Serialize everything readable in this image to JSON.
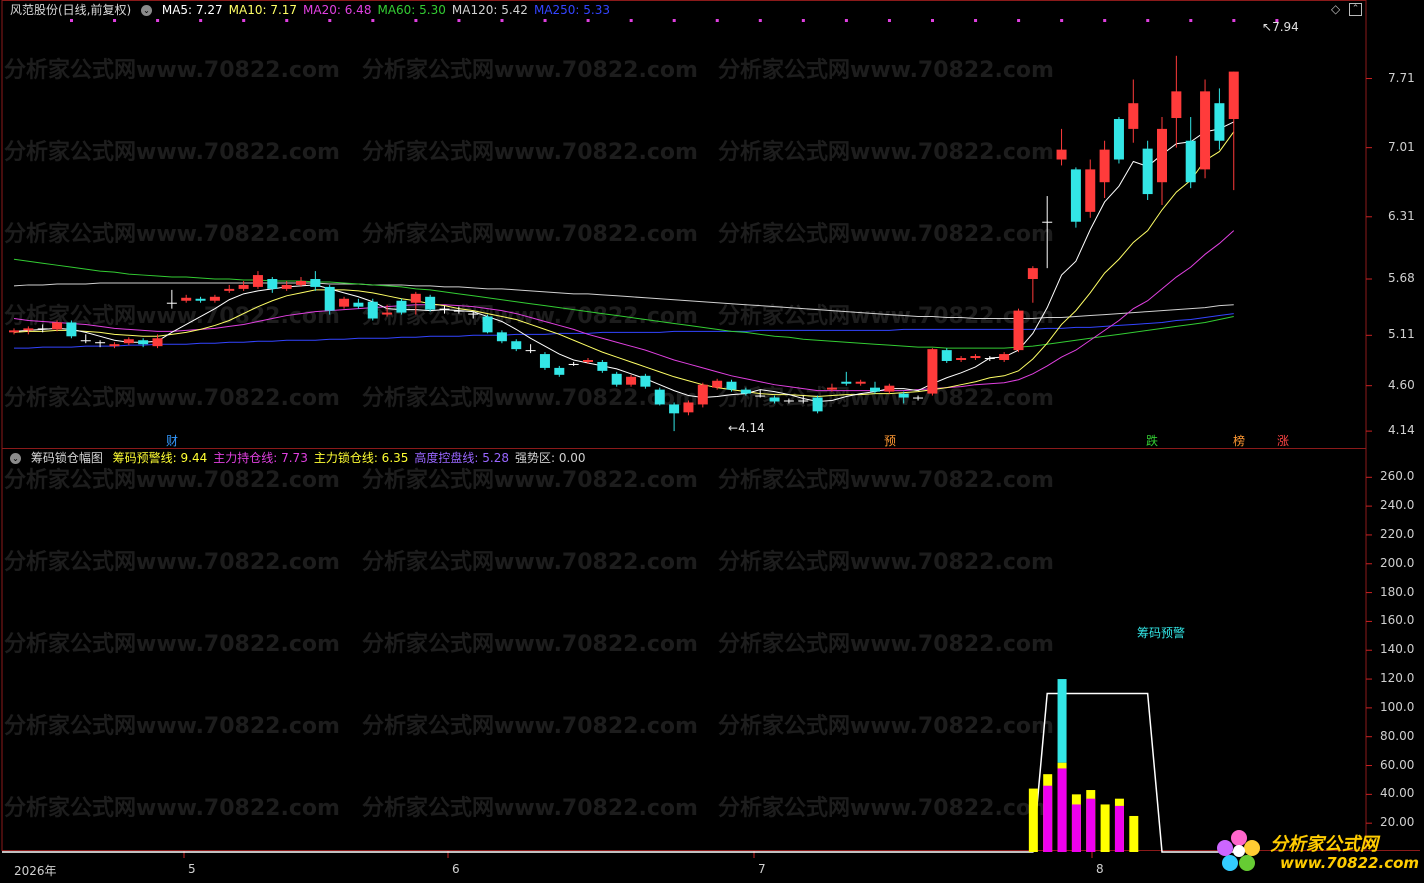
{
  "main_header": {
    "title": "风范股份(日线,前复权)",
    "indicators": [
      {
        "label": "MA5: 7.27",
        "color": "#ffffff"
      },
      {
        "label": "MA10: 7.17",
        "color": "#ffff66"
      },
      {
        "label": "MA20: 6.48",
        "color": "#e040e0"
      },
      {
        "label": "MA60: 5.30",
        "color": "#33cc33"
      },
      {
        "label": "MA120: 5.42",
        "color": "#d0d0d0"
      },
      {
        "label": "MA250: 5.33",
        "color": "#3344ff"
      }
    ]
  },
  "sub_header": {
    "title": "筹码锁仓幅图",
    "indicators": [
      {
        "label": "筹码预警线: 9.44",
        "color": "#ffff33"
      },
      {
        "label": "主力持仓线: 7.73",
        "color": "#e040e0"
      },
      {
        "label": "主力锁仓线: 6.35",
        "color": "#ffff33"
      },
      {
        "label": "高度控盘线: 5.28",
        "color": "#9966ff"
      },
      {
        "label": "强势区: 0.00",
        "color": "#d0d0d0"
      }
    ]
  },
  "price_axis": [
    "7.71",
    "7.01",
    "6.31",
    "5.68",
    "5.11",
    "4.60",
    "4.14"
  ],
  "indicator_axis": [
    "260.0",
    "240.0",
    "220.0",
    "200.0",
    "180.0",
    "160.0",
    "140.0",
    "120.0",
    "100.0",
    "80.00",
    "60.00",
    "40.00",
    "20.00"
  ],
  "x_axis": [
    "2026年",
    "5",
    "6",
    "7",
    "8"
  ],
  "annotations": {
    "high": "7.94",
    "low": "4.14",
    "sub_label": "筹码预警"
  },
  "event_markers": [
    {
      "text": "财",
      "color": "#3399ff"
    },
    {
      "text": "预",
      "color": "#ff9933"
    },
    {
      "text": "跌",
      "color": "#33cc33"
    },
    {
      "text": "榜",
      "color": "#ff9933"
    },
    {
      "text": "涨",
      "color": "#ff4444"
    }
  ],
  "watermark": "分析家公式网www.70822.com",
  "logo": {
    "brand": "分析家公式网",
    "url": "www.70822.com"
  },
  "colors": {
    "up": "#ff3b3b",
    "down": "#33e6e6",
    "bg": "#000000",
    "frame": "#8b1a1a"
  },
  "chart_data": {
    "type": "candlestick",
    "candles": [
      [
        5.14,
        5.16,
        5.12,
        5.18
      ],
      [
        5.16,
        5.18,
        5.12,
        5.2
      ],
      [
        5.18,
        5.17,
        5.14,
        5.22
      ],
      [
        5.17,
        5.24,
        5.15,
        5.26
      ],
      [
        5.24,
        5.1,
        5.08,
        5.26
      ],
      [
        5.06,
        5.05,
        5.03,
        5.12
      ],
      [
        5.04,
        5.03,
        4.99,
        5.06
      ],
      [
        5.0,
        5.02,
        4.98,
        5.04
      ],
      [
        5.03,
        5.07,
        5.01,
        5.09
      ],
      [
        5.06,
        5.02,
        4.99,
        5.08
      ],
      [
        5.0,
        5.08,
        4.98,
        5.12
      ],
      [
        5.44,
        5.44,
        5.38,
        5.57
      ],
      [
        5.46,
        5.49,
        5.44,
        5.52
      ],
      [
        5.48,
        5.46,
        5.44,
        5.5
      ],
      [
        5.46,
        5.5,
        5.44,
        5.52
      ],
      [
        5.56,
        5.58,
        5.54,
        5.62
      ],
      [
        5.58,
        5.62,
        5.56,
        5.66
      ],
      [
        5.6,
        5.72,
        5.58,
        5.76
      ],
      [
        5.68,
        5.58,
        5.54,
        5.7
      ],
      [
        5.58,
        5.62,
        5.56,
        5.66
      ],
      [
        5.62,
        5.66,
        5.6,
        5.7
      ],
      [
        5.68,
        5.6,
        5.56,
        5.76
      ],
      [
        5.6,
        5.36,
        5.32,
        5.62
      ],
      [
        5.4,
        5.48,
        5.38,
        5.5
      ],
      [
        5.44,
        5.4,
        5.38,
        5.48
      ],
      [
        5.45,
        5.28,
        5.26,
        5.48
      ],
      [
        5.32,
        5.34,
        5.3,
        5.42
      ],
      [
        5.46,
        5.34,
        5.32,
        5.48
      ],
      [
        5.44,
        5.53,
        5.32,
        5.55
      ],
      [
        5.5,
        5.37,
        5.35,
        5.52
      ],
      [
        5.38,
        5.37,
        5.33,
        5.41
      ],
      [
        5.36,
        5.36,
        5.33,
        5.4
      ],
      [
        5.33,
        5.32,
        5.28,
        5.35
      ],
      [
        5.3,
        5.14,
        5.13,
        5.32
      ],
      [
        5.14,
        5.05,
        5.03,
        5.16
      ],
      [
        5.05,
        4.97,
        4.95,
        5.07
      ],
      [
        4.96,
        4.96,
        4.93,
        5.02
      ],
      [
        4.92,
        4.78,
        4.76,
        4.94
      ],
      [
        4.78,
        4.71,
        4.69,
        4.8
      ],
      [
        4.82,
        4.82,
        4.8,
        4.84
      ],
      [
        4.84,
        4.86,
        4.82,
        4.88
      ],
      [
        4.84,
        4.75,
        4.73,
        4.86
      ],
      [
        4.72,
        4.61,
        4.59,
        4.74
      ],
      [
        4.61,
        4.69,
        4.59,
        4.71
      ],
      [
        4.7,
        4.59,
        4.57,
        4.72
      ],
      [
        4.56,
        4.41,
        4.4,
        4.58
      ],
      [
        4.41,
        4.32,
        4.14,
        4.43
      ],
      [
        4.33,
        4.43,
        4.3,
        4.45
      ],
      [
        4.41,
        4.61,
        4.38,
        4.63
      ],
      [
        4.58,
        4.65,
        4.56,
        4.67
      ],
      [
        4.64,
        4.56,
        4.54,
        4.66
      ],
      [
        4.56,
        4.52,
        4.5,
        4.58
      ],
      [
        4.5,
        4.5,
        4.48,
        4.56
      ],
      [
        4.48,
        4.44,
        4.42,
        4.5
      ],
      [
        4.44,
        4.45,
        4.42,
        4.47
      ],
      [
        4.44,
        4.45,
        4.42,
        4.5
      ],
      [
        4.48,
        4.34,
        4.32,
        4.5
      ],
      [
        4.56,
        4.58,
        4.54,
        4.62
      ],
      [
        4.64,
        4.62,
        4.6,
        4.74
      ],
      [
        4.62,
        4.64,
        4.6,
        4.66
      ],
      [
        4.58,
        4.54,
        4.52,
        4.64
      ],
      [
        4.54,
        4.6,
        4.52,
        4.62
      ],
      [
        4.52,
        4.48,
        4.42,
        4.54
      ],
      [
        4.48,
        4.47,
        4.45,
        4.5
      ],
      [
        4.52,
        4.97,
        4.5,
        4.98
      ],
      [
        4.96,
        4.85,
        4.83,
        4.98
      ],
      [
        4.86,
        4.88,
        4.84,
        4.9
      ],
      [
        4.88,
        4.9,
        4.86,
        4.92
      ],
      [
        4.88,
        4.87,
        4.85,
        4.9
      ],
      [
        4.86,
        4.92,
        4.84,
        4.94
      ],
      [
        4.96,
        5.36,
        4.94,
        5.38
      ],
      [
        5.68,
        5.79,
        5.44,
        5.81
      ],
      [
        6.26,
        6.26,
        5.79,
        6.52
      ],
      [
        6.89,
        6.99,
        6.83,
        7.2
      ],
      [
        6.79,
        6.26,
        6.2,
        6.81
      ],
      [
        6.36,
        6.79,
        6.3,
        6.89
      ],
      [
        6.66,
        6.99,
        6.5,
        7.08
      ],
      [
        7.3,
        6.89,
        6.85,
        7.32
      ],
      [
        7.2,
        7.46,
        7.06,
        7.7
      ],
      [
        7.0,
        6.54,
        6.48,
        7.08
      ],
      [
        6.66,
        7.2,
        6.43,
        7.32
      ],
      [
        7.31,
        7.58,
        7.01,
        7.94
      ],
      [
        7.08,
        6.66,
        6.6,
        7.32
      ],
      [
        6.79,
        7.58,
        6.7,
        7.7
      ],
      [
        7.46,
        7.08,
        6.99,
        7.61
      ],
      [
        7.3,
        7.78,
        6.58,
        7.78
      ]
    ],
    "ma5": [
      5.15,
      5.16,
      5.17,
      5.18,
      5.17,
      5.14,
      5.1,
      5.06,
      5.04,
      5.04,
      5.05,
      5.14,
      5.22,
      5.3,
      5.38,
      5.47,
      5.53,
      5.56,
      5.58,
      5.6,
      5.61,
      5.62,
      5.58,
      5.54,
      5.5,
      5.45,
      5.38,
      5.37,
      5.37,
      5.36,
      5.37,
      5.36,
      5.35,
      5.3,
      5.25,
      5.17,
      5.08,
      5.0,
      4.92,
      4.86,
      4.83,
      4.8,
      4.77,
      4.72,
      4.67,
      4.61,
      4.55,
      4.5,
      4.48,
      4.49,
      4.51,
      4.52,
      4.56,
      4.54,
      4.51,
      4.47,
      4.44,
      4.45,
      4.49,
      4.52,
      4.54,
      4.57,
      4.57,
      4.55,
      4.62,
      4.68,
      4.73,
      4.79,
      4.88,
      4.89,
      4.96,
      5.13,
      5.39,
      5.72,
      5.86,
      6.18,
      6.46,
      6.62,
      6.87,
      6.82,
      6.94,
      7.05,
      7.07,
      7.17,
      7.2,
      7.27
    ],
    "ma10": [
      5.14,
      5.15,
      5.15,
      5.16,
      5.16,
      5.15,
      5.14,
      5.12,
      5.11,
      5.1,
      5.1,
      5.12,
      5.14,
      5.17,
      5.21,
      5.26,
      5.33,
      5.4,
      5.46,
      5.51,
      5.54,
      5.57,
      5.57,
      5.57,
      5.56,
      5.54,
      5.51,
      5.48,
      5.46,
      5.43,
      5.41,
      5.38,
      5.36,
      5.33,
      5.3,
      5.27,
      5.22,
      5.17,
      5.12,
      5.06,
      5.0,
      4.94,
      4.89,
      4.84,
      4.79,
      4.74,
      4.69,
      4.65,
      4.61,
      4.58,
      4.56,
      4.54,
      4.52,
      4.51,
      4.51,
      4.5,
      4.49,
      4.5,
      4.51,
      4.51,
      4.52,
      4.52,
      4.53,
      4.54,
      4.56,
      4.58,
      4.61,
      4.64,
      4.68,
      4.7,
      4.75,
      4.87,
      5.03,
      5.22,
      5.36,
      5.54,
      5.74,
      5.88,
      6.05,
      6.17,
      6.38,
      6.56,
      6.68,
      6.88,
      6.97,
      7.17
    ],
    "ma20": [
      5.28,
      5.26,
      5.25,
      5.24,
      5.23,
      5.22,
      5.2,
      5.18,
      5.17,
      5.16,
      5.15,
      5.15,
      5.16,
      5.17,
      5.18,
      5.2,
      5.22,
      5.25,
      5.28,
      5.31,
      5.33,
      5.35,
      5.36,
      5.37,
      5.38,
      5.39,
      5.4,
      5.41,
      5.42,
      5.42,
      5.42,
      5.41,
      5.4,
      5.38,
      5.36,
      5.33,
      5.29,
      5.25,
      5.21,
      5.17,
      5.12,
      5.08,
      5.04,
      5.0,
      4.96,
      4.91,
      4.86,
      4.82,
      4.78,
      4.74,
      4.7,
      4.67,
      4.64,
      4.61,
      4.59,
      4.57,
      4.55,
      4.55,
      4.55,
      4.55,
      4.55,
      4.55,
      4.55,
      4.56,
      4.57,
      4.58,
      4.59,
      4.61,
      4.62,
      4.63,
      4.66,
      4.72,
      4.8,
      4.89,
      4.96,
      5.06,
      5.16,
      5.26,
      5.38,
      5.46,
      5.58,
      5.7,
      5.8,
      5.93,
      6.04,
      6.17
    ],
    "ma60": [
      5.88,
      5.86,
      5.84,
      5.82,
      5.8,
      5.78,
      5.76,
      5.75,
      5.73,
      5.72,
      5.71,
      5.7,
      5.7,
      5.69,
      5.68,
      5.68,
      5.67,
      5.67,
      5.66,
      5.66,
      5.66,
      5.65,
      5.65,
      5.64,
      5.63,
      5.62,
      5.61,
      5.6,
      5.58,
      5.57,
      5.55,
      5.53,
      5.51,
      5.49,
      5.47,
      5.45,
      5.43,
      5.41,
      5.39,
      5.37,
      5.35,
      5.33,
      5.31,
      5.29,
      5.27,
      5.25,
      5.23,
      5.21,
      5.19,
      5.17,
      5.15,
      5.14,
      5.12,
      5.1,
      5.09,
      5.07,
      5.06,
      5.05,
      5.04,
      5.03,
      5.02,
      5.01,
      5.0,
      4.99,
      4.99,
      4.98,
      4.98,
      4.98,
      4.98,
      4.98,
      4.99,
      5.0,
      5.02,
      5.04,
      5.06,
      5.08,
      5.1,
      5.12,
      5.14,
      5.16,
      5.18,
      5.2,
      5.22,
      5.24,
      5.27,
      5.3
    ],
    "ma120": [
      5.61,
      5.62,
      5.62,
      5.63,
      5.63,
      5.63,
      5.64,
      5.64,
      5.64,
      5.64,
      5.64,
      5.64,
      5.64,
      5.64,
      5.64,
      5.64,
      5.64,
      5.64,
      5.64,
      5.64,
      5.64,
      5.64,
      5.63,
      5.63,
      5.63,
      5.62,
      5.62,
      5.62,
      5.61,
      5.61,
      5.6,
      5.6,
      5.59,
      5.58,
      5.58,
      5.57,
      5.56,
      5.55,
      5.54,
      5.53,
      5.53,
      5.52,
      5.51,
      5.5,
      5.49,
      5.48,
      5.47,
      5.46,
      5.45,
      5.44,
      5.43,
      5.42,
      5.41,
      5.4,
      5.39,
      5.38,
      5.37,
      5.36,
      5.35,
      5.34,
      5.33,
      5.32,
      5.31,
      5.3,
      5.3,
      5.29,
      5.29,
      5.28,
      5.28,
      5.28,
      5.28,
      5.28,
      5.29,
      5.29,
      5.3,
      5.31,
      5.32,
      5.33,
      5.34,
      5.35,
      5.36,
      5.37,
      5.38,
      5.39,
      5.41,
      5.42
    ],
    "ma250": [
      4.98,
      4.98,
      4.99,
      4.99,
      4.99,
      5.0,
      5.0,
      5.0,
      5.01,
      5.01,
      5.02,
      5.02,
      5.02,
      5.03,
      5.03,
      5.04,
      5.04,
      5.05,
      5.05,
      5.06,
      5.06,
      5.06,
      5.07,
      5.07,
      5.08,
      5.08,
      5.08,
      5.09,
      5.09,
      5.1,
      5.1,
      5.1,
      5.11,
      5.11,
      5.11,
      5.12,
      5.12,
      5.12,
      5.13,
      5.13,
      5.13,
      5.14,
      5.14,
      5.14,
      5.14,
      5.14,
      5.15,
      5.15,
      5.15,
      5.15,
      5.15,
      5.15,
      5.16,
      5.16,
      5.16,
      5.16,
      5.16,
      5.16,
      5.16,
      5.16,
      5.16,
      5.16,
      5.17,
      5.17,
      5.17,
      5.17,
      5.17,
      5.17,
      5.17,
      5.17,
      5.17,
      5.17,
      5.18,
      5.18,
      5.19,
      5.19,
      5.2,
      5.21,
      5.22,
      5.23,
      5.24,
      5.26,
      5.27,
      5.29,
      5.31,
      5.33
    ],
    "indicator": {
      "envelope": [
        0,
        0,
        0,
        0,
        0,
        0,
        0,
        0,
        0,
        0,
        0,
        0,
        0,
        0,
        0,
        0,
        0,
        0,
        0,
        0,
        0,
        0,
        0,
        0,
        0,
        0,
        0,
        0,
        0,
        0,
        0,
        0,
        0,
        0,
        0,
        0,
        0,
        0,
        0,
        0,
        0,
        0,
        0,
        0,
        0,
        0,
        0,
        0,
        0,
        0,
        0,
        0,
        0,
        0,
        0,
        0,
        0,
        0,
        0,
        0,
        0,
        0,
        0,
        0,
        0,
        0,
        0,
        0,
        0,
        0,
        0,
        0,
        110,
        110,
        110,
        110,
        110,
        110,
        110,
        110,
        0,
        0,
        0,
        0,
        0,
        0
      ],
      "yellow": [
        0,
        0,
        0,
        0,
        0,
        0,
        0,
        0,
        0,
        0,
        0,
        0,
        0,
        0,
        0,
        0,
        0,
        0,
        0,
        0,
        0,
        0,
        0,
        0,
        0,
        0,
        0,
        0,
        0,
        0,
        0,
        0,
        0,
        0,
        0,
        0,
        0,
        0,
        0,
        0,
        0,
        0,
        0,
        0,
        0,
        0,
        0,
        0,
        0,
        0,
        0,
        0,
        0,
        0,
        0,
        0,
        0,
        0,
        0,
        0,
        0,
        0,
        0,
        0,
        0,
        0,
        0,
        0,
        0,
        0,
        0,
        44,
        54,
        62,
        40,
        43,
        33,
        37,
        25,
        0,
        0,
        0,
        0,
        0,
        0,
        0
      ],
      "magenta": [
        0,
        0,
        0,
        0,
        0,
        0,
        0,
        0,
        0,
        0,
        0,
        0,
        0,
        0,
        0,
        0,
        0,
        0,
        0,
        0,
        0,
        0,
        0,
        0,
        0,
        0,
        0,
        0,
        0,
        0,
        0,
        0,
        0,
        0,
        0,
        0,
        0,
        0,
        0,
        0,
        0,
        0,
        0,
        0,
        0,
        0,
        0,
        0,
        0,
        0,
        0,
        0,
        0,
        0,
        0,
        0,
        0,
        0,
        0,
        0,
        0,
        0,
        0,
        0,
        0,
        0,
        0,
        0,
        0,
        0,
        0,
        0,
        46,
        58,
        33,
        37,
        0,
        32,
        0,
        0,
        0,
        0,
        0,
        0,
        0,
        0
      ],
      "cyan": [
        0,
        0,
        0,
        0,
        0,
        0,
        0,
        0,
        0,
        0,
        0,
        0,
        0,
        0,
        0,
        0,
        0,
        0,
        0,
        0,
        0,
        0,
        0,
        0,
        0,
        0,
        0,
        0,
        0,
        0,
        0,
        0,
        0,
        0,
        0,
        0,
        0,
        0,
        0,
        0,
        0,
        0,
        0,
        0,
        0,
        0,
        0,
        0,
        0,
        0,
        0,
        0,
        0,
        0,
        0,
        0,
        0,
        0,
        0,
        0,
        0,
        0,
        0,
        0,
        0,
        0,
        0,
        0,
        0,
        0,
        0,
        0,
        0,
        120,
        0,
        0,
        0,
        0,
        0,
        0,
        0,
        0,
        0,
        0,
        0,
        0
      ]
    },
    "price_range": [
      4.05,
      8.1
    ],
    "indicator_range": [
      0,
      272
    ]
  }
}
